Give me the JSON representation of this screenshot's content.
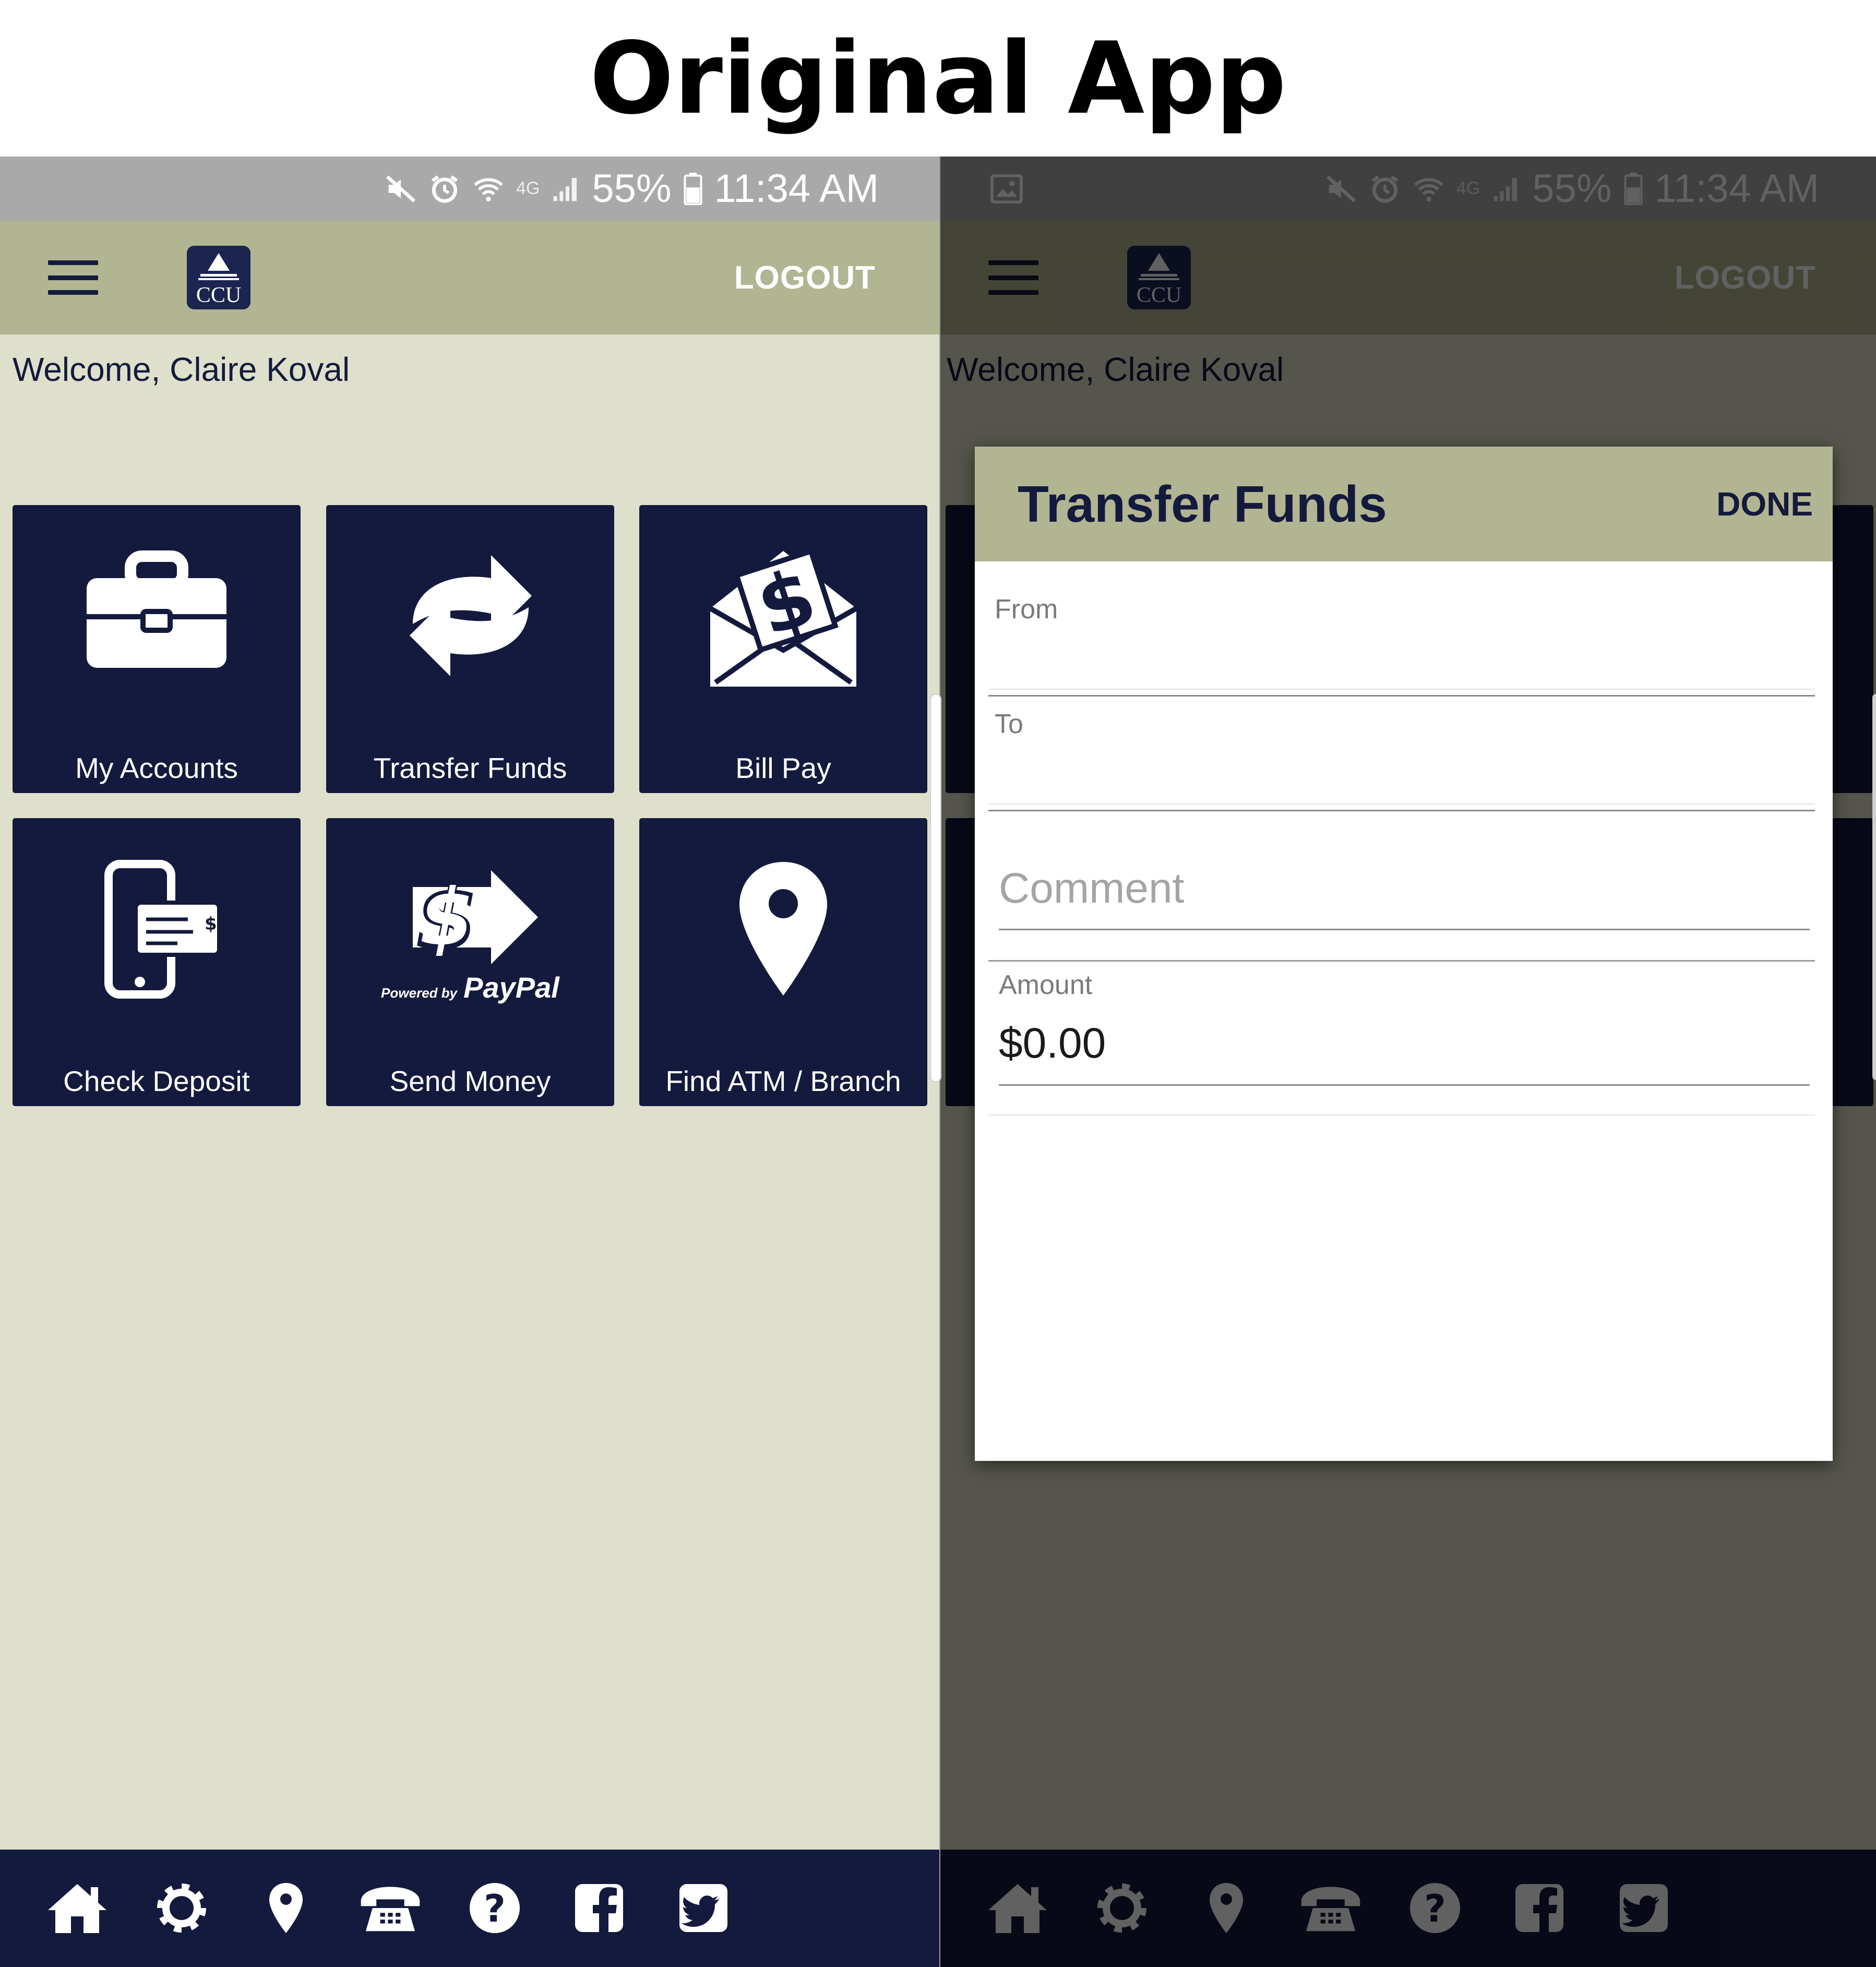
{
  "heading": "Original App",
  "colors": {
    "navy": "#141a3d",
    "olive": "#b2b592",
    "background": "#dfe0cb"
  },
  "status": {
    "battery": "55%",
    "time": "11:34 AM",
    "network": "4G"
  },
  "header": {
    "logo_text": "CCU",
    "logout_label": "LOGOUT"
  },
  "welcome": "Welcome, Claire Koval",
  "tiles": [
    {
      "label": "My Accounts",
      "icon": "briefcase-icon"
    },
    {
      "label": "Transfer Funds",
      "icon": "transfer-arrows-icon"
    },
    {
      "label": "Bill Pay",
      "icon": "bill-envelope-icon"
    },
    {
      "label": "Check Deposit",
      "icon": "phone-check-icon"
    },
    {
      "label": "Send Money",
      "icon": "paypal-send-icon",
      "sublabel": "Powered by",
      "brand": "PayPal"
    },
    {
      "label": "Find ATM / Branch",
      "icon": "map-pin-icon"
    }
  ],
  "bottom_nav": [
    "home-icon",
    "gear-icon",
    "location-icon",
    "phone-icon",
    "help-icon",
    "facebook-icon",
    "twitter-icon"
  ],
  "dialog": {
    "title": "Transfer Funds",
    "done_label": "DONE",
    "from_label": "From",
    "to_label": "To",
    "comment_placeholder": "Comment",
    "amount_label": "Amount",
    "amount_value": "$0.00"
  }
}
